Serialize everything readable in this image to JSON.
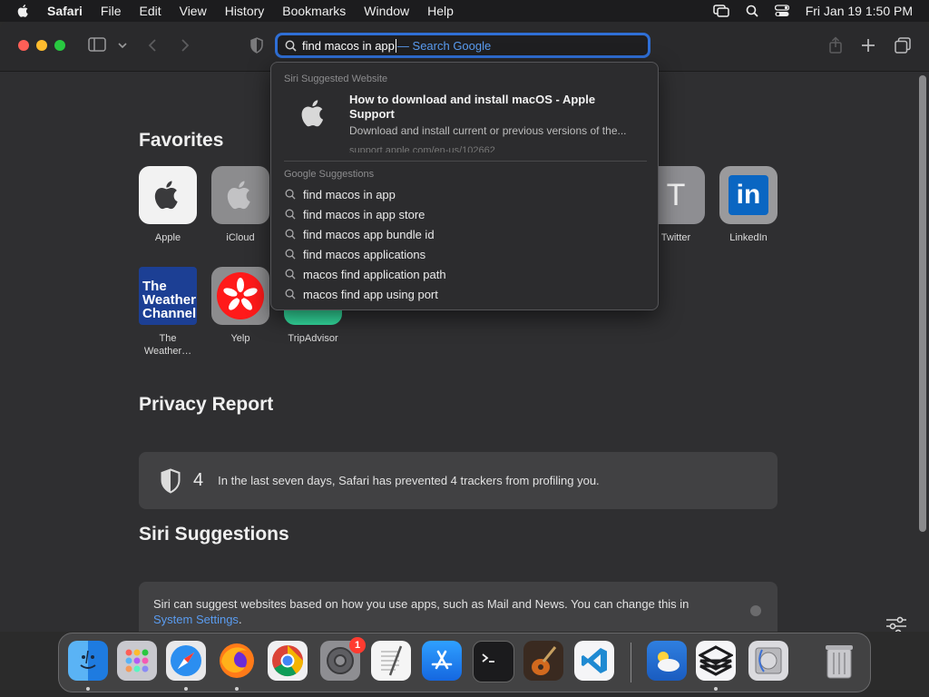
{
  "menubar": {
    "app": "Safari",
    "items": [
      "File",
      "Edit",
      "View",
      "History",
      "Bookmarks",
      "Window",
      "Help"
    ],
    "clock": "Fri Jan 19  1:50 PM"
  },
  "urlbar": {
    "typed": "find macos in app",
    "hint": "— Search Google"
  },
  "favorites": {
    "title": "Favorites",
    "items": [
      {
        "label": "Apple"
      },
      {
        "label": "iCloud"
      },
      {
        "label": "Twitter",
        "glyph": "T"
      },
      {
        "label": "LinkedIn",
        "glyph": "in"
      },
      {
        "label": "The Weather…",
        "glyph": "The Weather Channel"
      },
      {
        "label": "Yelp"
      },
      {
        "label": "TripAdvisor"
      }
    ]
  },
  "dropdown": {
    "siri_header": "Siri Suggested Website",
    "site_title": "How to download and install macOS - Apple Support",
    "site_desc": "Download and install current or previous versions of the...",
    "site_url": "support.apple.com/en-us/102662",
    "google_header": "Google Suggestions",
    "suggestions": [
      "find macos in app",
      "find macos in app store",
      "find macos app bundle id",
      "find macos applications",
      "macos find application path",
      "macos find app using port"
    ]
  },
  "privacy": {
    "title": "Privacy Report",
    "count": "4",
    "text": "In the last seven days, Safari has prevented 4 trackers from profiling you."
  },
  "siri": {
    "title": "Siri Suggestions",
    "text": "Siri can suggest websites based on how you use apps, such as Mail and News. You can change this in",
    "link": "System Settings",
    "period": "."
  },
  "dock": {
    "badge": "1"
  },
  "colors": {
    "accent": "#2f6fd6",
    "link": "#5a9cf0",
    "linkedin": "#0a66c2",
    "weather": "#1c3f94",
    "yelp": "#ff1a1a",
    "tripadvisor": "#34e0a1"
  }
}
